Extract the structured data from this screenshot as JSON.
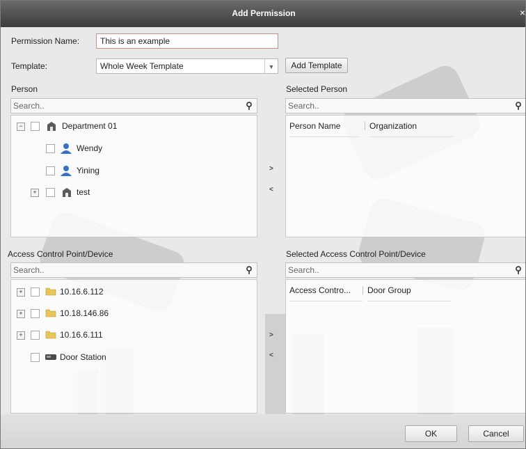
{
  "window": {
    "title": "Add Permission"
  },
  "permission_name": {
    "label": "Permission Name:",
    "value": "This is an example"
  },
  "template": {
    "label": "Template:",
    "value": "Whole Week Template",
    "add_button": "Add Template"
  },
  "person_panel": {
    "title": "Person",
    "search_placeholder": "Search..",
    "tree": [
      {
        "label": "Department 01",
        "icon": "building-icon",
        "expander": "−"
      },
      {
        "label": "Wendy",
        "icon": "person-icon"
      },
      {
        "label": "Yining",
        "icon": "person-icon"
      },
      {
        "label": "test",
        "icon": "building-icon",
        "expander": "+"
      }
    ]
  },
  "selected_person_panel": {
    "title": "Selected Person",
    "search_placeholder": "Search..",
    "columns": [
      "Person Name",
      "Organization"
    ]
  },
  "device_panel": {
    "title": "Access Control Point/Device",
    "search_placeholder": "Search..",
    "tree": [
      {
        "label": "10.16.6.112",
        "icon": "folder-icon",
        "expander": "+"
      },
      {
        "label": "10.18.146.86",
        "icon": "folder-icon",
        "expander": "+"
      },
      {
        "label": "10.16.6.111",
        "icon": "folder-icon",
        "expander": "+"
      },
      {
        "label": "Door Station",
        "icon": "door-station-icon"
      }
    ]
  },
  "selected_device_panel": {
    "title": "Selected Access Control Point/Device",
    "search_placeholder": "Search..",
    "columns": [
      "Access Contro...",
      "Door Group"
    ]
  },
  "transfer": {
    "add": ">",
    "remove": "<"
  },
  "footer": {
    "ok": "OK",
    "cancel": "Cancel"
  }
}
